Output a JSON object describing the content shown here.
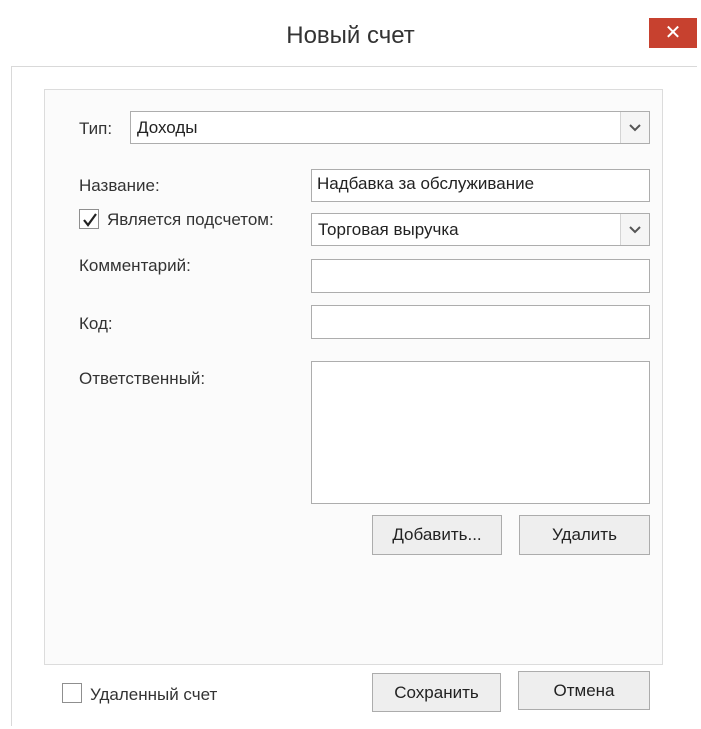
{
  "window": {
    "title": "Новый счет",
    "close_glyph": "✕"
  },
  "form": {
    "type_label": "Тип:",
    "type_value": "Доходы",
    "name_label": "Название:",
    "name_value": "Надбавка за обслуживание",
    "subaccount_label": "Является подсчетом:",
    "subaccount_checked": true,
    "subaccount_value": "Торговая выручка",
    "comment_label": "Комментарий:",
    "comment_value": "",
    "code_label": "Код:",
    "code_value": "",
    "responsible_label": "Ответственный:",
    "responsible_items": []
  },
  "buttons": {
    "add_label": "Добавить...",
    "delete_label": "Удалить",
    "save_label": "Сохранить",
    "cancel_label": "Отмена"
  },
  "footer": {
    "deleted_account_label": "Удаленный счет",
    "deleted_account_checked": false
  },
  "colors": {
    "close_button": "#c7412f",
    "border": "#adadad",
    "button_bg": "#eeeeee"
  },
  "icons": {
    "close": "close-icon",
    "dropdown": "chevron-down-icon",
    "check": "check-icon"
  }
}
